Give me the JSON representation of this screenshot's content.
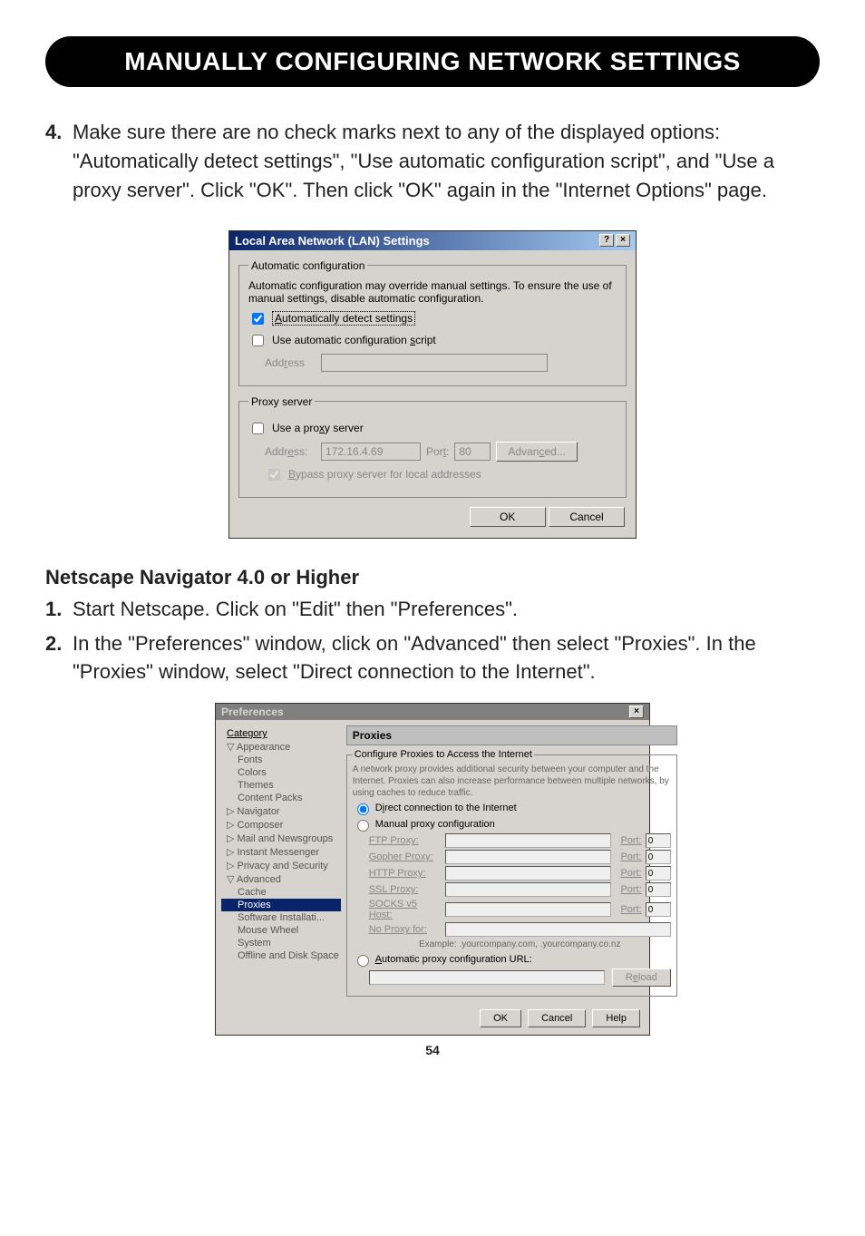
{
  "header": {
    "title": "MANUALLY CONFIGURING NETWORK SETTINGS"
  },
  "step4": {
    "num": "4.",
    "text": "Make sure there are no check marks next to any of the displayed options: \"Automatically detect settings\", \"Use automatic configuration script\", and \"Use a proxy server\". Click \"OK\". Then click \"OK\" again in the \"Internet Options\" page."
  },
  "lan_dialog": {
    "title": "Local Area Network (LAN) Settings",
    "help_btn": "?",
    "close_btn": "×",
    "auto_group": {
      "legend": "Automatic configuration",
      "desc": "Automatic configuration may override manual settings.  To ensure the use of manual settings, disable automatic configuration.",
      "auto_detect": "Automatically detect settings",
      "use_script": "Use automatic configuration script",
      "address_label": "Address",
      "address_value": ""
    },
    "proxy_group": {
      "legend": "Proxy server",
      "use_proxy": "Use a proxy server",
      "address_label": "Address:",
      "address_value": "172.16.4.69",
      "port_label": "Port:",
      "port_value": "80",
      "advanced": "Advanced...",
      "bypass": "Bypass proxy server for local addresses"
    },
    "ok": "OK",
    "cancel": "Cancel"
  },
  "netscape": {
    "subhead": "Netscape Navigator 4.0 or Higher",
    "step1": {
      "num": "1.",
      "text": "Start Netscape. Click on \"Edit\" then \"Preferences\"."
    },
    "step2": {
      "num": "2.",
      "text": "In the \"Preferences\" window, click on \"Advanced\" then select \"Proxies\". In the \"Proxies\" window, select \"Direct connection to the Internet\"."
    }
  },
  "prefs_dialog": {
    "title": "Preferences",
    "close_btn": "×",
    "cat_header": "Category",
    "tree": [
      "▽ Appearance",
      "Fonts",
      "Colors",
      "Themes",
      "Content Packs",
      "▷ Navigator",
      "▷ Composer",
      "▷ Mail and Newsgroups",
      "▷ Instant Messenger",
      "▷ Privacy and Security",
      "▽ Advanced",
      "Cache",
      "Proxies",
      "Software Installati...",
      "Mouse Wheel",
      "System",
      "Offline and Disk Space"
    ],
    "panel_title": "Proxies",
    "fieldset_legend": "Configure Proxies to Access the Internet",
    "intro": "A network proxy provides additional security between your computer and the Internet. Proxies can also increase performance between multiple networks, by using caches to reduce traffic.",
    "r_direct": "Direct connection to the Internet",
    "r_manual": "Manual proxy configuration",
    "rows": {
      "ftp": "FTP Proxy:",
      "gopher": "Gopher Proxy:",
      "http": "HTTP Proxy:",
      "ssl": "SSL Proxy:",
      "socks": "SOCKS v5 Host:",
      "noproxy": "No Proxy for:",
      "port": "Port:",
      "port_val": "0"
    },
    "example": "Example: .yourcompany.com, .yourcompany.co.nz",
    "r_auto": "Automatic proxy configuration URL:",
    "reload": "Reload",
    "ok": "OK",
    "cancel": "Cancel",
    "help": "Help"
  },
  "page_number": "54"
}
